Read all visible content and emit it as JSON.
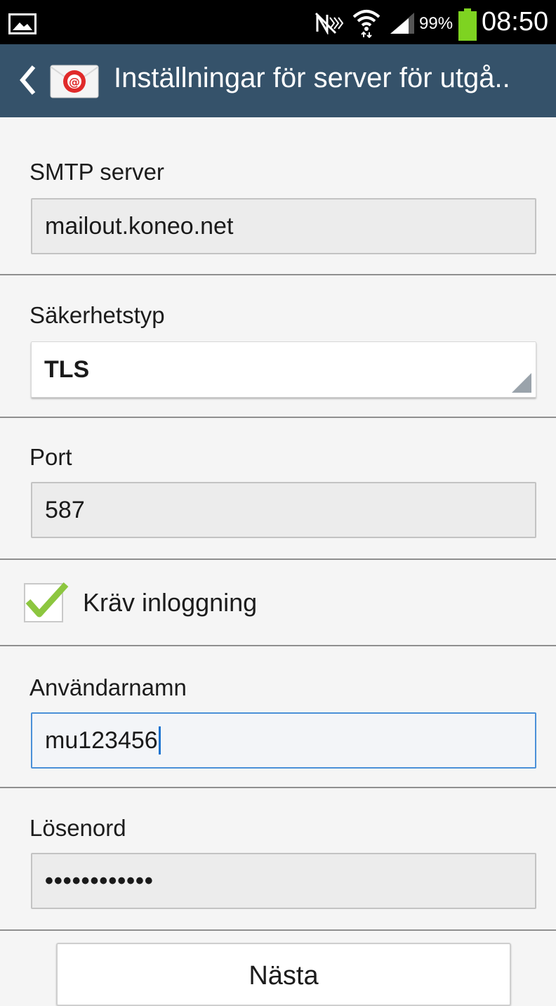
{
  "status_bar": {
    "battery_percent": "99%",
    "time": "08:50",
    "icons": [
      "image-notification-icon",
      "mute-icon",
      "wifi-icon",
      "signal-icon",
      "battery-icon"
    ]
  },
  "action_bar": {
    "title": "Inställningar för server för utgå..",
    "back_icon": "chevron-left-icon",
    "app_icon": "email-app-icon"
  },
  "form": {
    "smtp_server": {
      "label": "SMTP server",
      "value": "mailout.koneo.net"
    },
    "security_type": {
      "label": "Säkerhetstyp",
      "value": "TLS"
    },
    "port": {
      "label": "Port",
      "value": "587"
    },
    "require_login": {
      "label": "Kräv inloggning",
      "checked": true
    },
    "username": {
      "label": "Användarnamn",
      "value": "mu123456"
    },
    "password": {
      "label": "Lösenord",
      "value": "••••••••••••"
    }
  },
  "buttons": {
    "next_label": "Nästa"
  },
  "colors": {
    "action_bar": "#35526a",
    "focus_border": "#4a90d8",
    "check_green": "#8cc63f",
    "battery_green": "#7ed321"
  }
}
